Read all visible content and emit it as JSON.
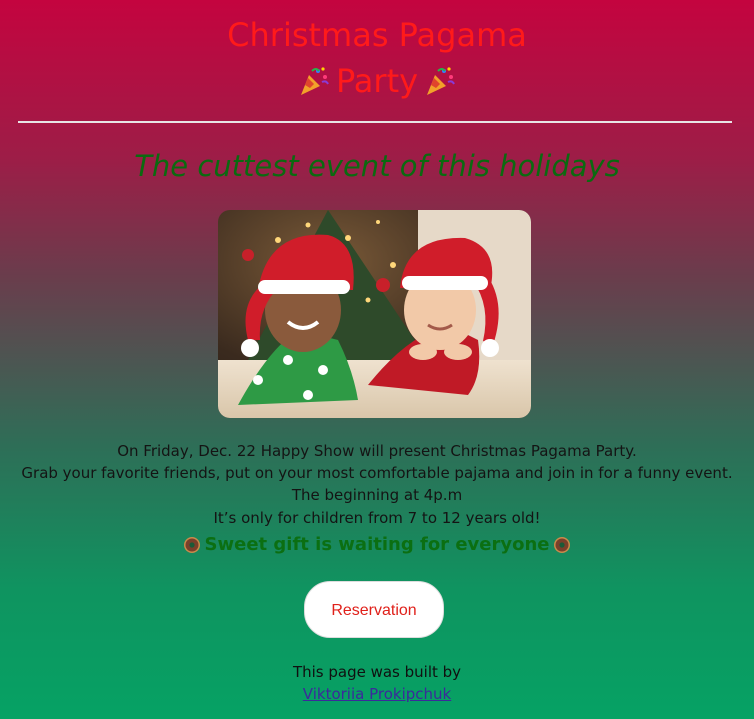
{
  "header": {
    "title_line1": "Christmas Pagama",
    "title_line2": "Party",
    "subtitle": "The cuttest event of this holidays"
  },
  "details": {
    "line1": "On Friday, Dec. 22 Happy Show will present Christmas Pagama Party.",
    "line2": "Grab your favorite friends, put on your most comfortable pajama and join in for a funny event.",
    "line3": "The beginning at 4p.m",
    "line4": "It’s only for children from 7 to 12 years old!",
    "gift": "Sweet gift is waiting for everyone"
  },
  "reservation": {
    "label": "Reservation"
  },
  "footer": {
    "built_by": "This page was built by",
    "author": "Viktoriia Prokipchuk"
  },
  "icons": {
    "title_icon": "party-popper-icon",
    "gift_icon": "donut-icon"
  },
  "colors": {
    "title": "#ff1a1a",
    "subtitle": "#0b6a10",
    "gift": "#0b6f12",
    "button_text": "#e0201a",
    "link": "#3b2a9b"
  }
}
